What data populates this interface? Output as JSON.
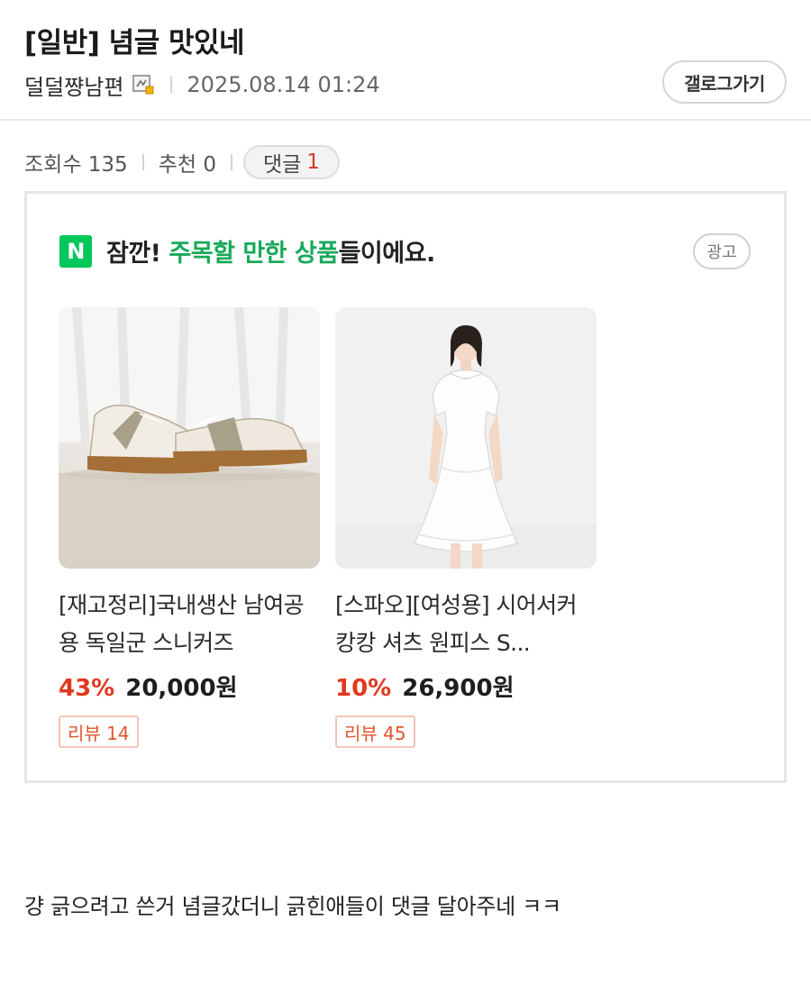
{
  "post": {
    "title": "[일반] 념글 맛있네",
    "author": "덜덜쨩남편",
    "date": "2025.08.14 01:24",
    "gallery_button": "갤로그가기",
    "stats": {
      "views_label": "조회수 135",
      "recommend_label": "추천 0",
      "comments_label": "댓글",
      "comments_count": "1"
    },
    "body": "걍 긁으려고 쓴거 념글갔더니 긁힌애들이 댓글 달아주네 ㅋㅋ"
  },
  "ad": {
    "logo_letter": "N",
    "headline_prefix": "잠깐! ",
    "headline_highlight": "주목할 만한 상품",
    "headline_suffix": "들이에요.",
    "badge": "광고",
    "products": [
      {
        "name": "[재고정리]국내생산 남여공용 독일군 스니커즈",
        "discount": "43%",
        "price": "20,000원",
        "review": "리뷰 14"
      },
      {
        "name": "[스파오][여성용] 시어서커 캉캉 셔츠 원피스 S...",
        "discount": "10%",
        "price": "26,900원",
        "review": "리뷰 45"
      }
    ]
  },
  "colors": {
    "naver_green": "#03c75a",
    "highlight_green": "#19a95a",
    "discount_red": "#e0391f",
    "comment_count_red": "#d5392a"
  },
  "icons": {
    "author_badge": "gallog-badge-icon"
  }
}
